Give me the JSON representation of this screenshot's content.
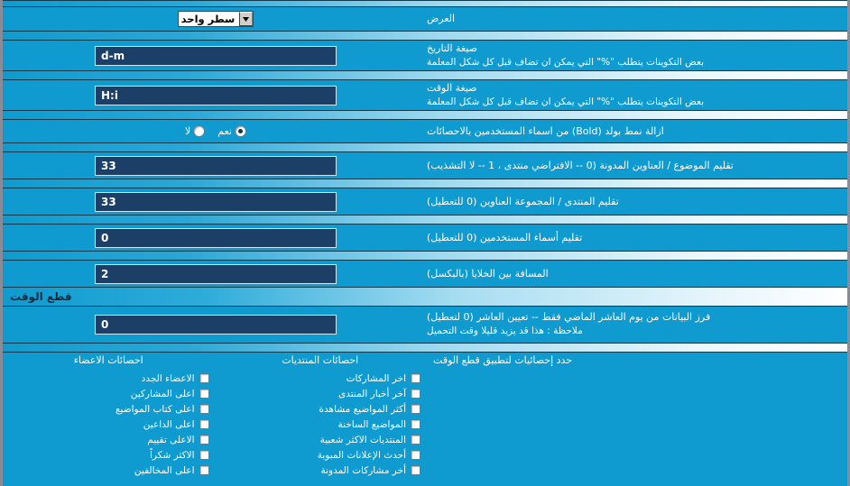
{
  "theme": {
    "background": "#0f9bd0",
    "input_bg": "#1b3f66",
    "input_border": "#cfe8f5",
    "frame_border": "#8b8b97",
    "header_text": "#0b2d3f"
  },
  "settings": [
    {
      "name": "display",
      "title": "العرض",
      "desc": "",
      "control": "select",
      "value": "سطر واحد"
    },
    {
      "name": "date-format",
      "title": "صيغة التاريخ",
      "desc": "بعض التكوينات يتطلب \"%\" التي يمكن ان تضاف قبل كل شكل المعلمة",
      "control": "text",
      "value": "d-m"
    },
    {
      "name": "time-format",
      "title": "صيغة الوقت",
      "desc": "بعض التكوينات يتطلب \"%\" التي يمكن ان تضاف قبل كل شكل المعلمة",
      "control": "text",
      "value": "H:i"
    },
    {
      "name": "remove-bold",
      "title": "ازالة نمط بولد (Bold) من اسماء المستخدمين بالاحصائات",
      "desc": "",
      "control": "radio",
      "options": [
        {
          "label": "نعم",
          "selected": true
        },
        {
          "label": "لا",
          "selected": false
        }
      ]
    },
    {
      "name": "trim-thread-blog-titles",
      "title": "تقليم الموضوع / العناوين المدونة (0 -- الافتراضي منتدى ، 1 -- لا التشذيب)",
      "desc": "",
      "control": "text",
      "value": "33"
    },
    {
      "name": "trim-forum-group-titles",
      "title": "تقليم المنتدى / المجموعة العناوين (0 للتعطيل)",
      "desc": "",
      "control": "text",
      "value": "33"
    },
    {
      "name": "trim-usernames",
      "title": "تقليم أسماء المستخدمين (0 للتعطيل)",
      "desc": "",
      "control": "text",
      "value": "0"
    },
    {
      "name": "cell-spacing",
      "title": "المسافة بين الخلايا (بالبكسل)",
      "desc": "",
      "control": "text",
      "value": "2"
    }
  ],
  "section": {
    "title": "قطع الوقت",
    "cutoff": {
      "name": "cutoff-days",
      "title": "فرز البيانات من يوم العاشر الماضي فقط -- تعيين العاشر (0 لتعطيل)",
      "desc": "ملاحظة : هذا قد يزيد قليلا وقت التحميل",
      "value": "0"
    },
    "stats_heading": "حدد إحصائيات لتطبيق قطع الوقت",
    "columns": [
      {
        "name": "forum-stats",
        "title": "احصائات المنتديات",
        "items": [
          {
            "label": "اخر المشاركات",
            "checked": false
          },
          {
            "label": "آخر أخبار المنتدى",
            "checked": false
          },
          {
            "label": "أكثر المواضيع مشاهدة",
            "checked": false
          },
          {
            "label": "المواضيع الساخنة",
            "checked": false
          },
          {
            "label": "المنتديات الاكثر شعبية",
            "checked": false
          },
          {
            "label": "أحدث الإعلانات المبوبة",
            "checked": false
          },
          {
            "label": "أخر مشاركات المدونة",
            "checked": false
          }
        ]
      },
      {
        "name": "member-stats",
        "title": "احصائات الاعضاء",
        "items": [
          {
            "label": "الاعضاء الجدد",
            "checked": false
          },
          {
            "label": "اعلى المشاركين",
            "checked": false
          },
          {
            "label": "اعلى كتاب المواضيع",
            "checked": false
          },
          {
            "label": "اعلى الداعين",
            "checked": false
          },
          {
            "label": "الاعلى تقييم",
            "checked": false
          },
          {
            "label": "الاكثر شكراً",
            "checked": false
          },
          {
            "label": "اعلى المخالفين",
            "checked": false
          }
        ]
      }
    ]
  }
}
